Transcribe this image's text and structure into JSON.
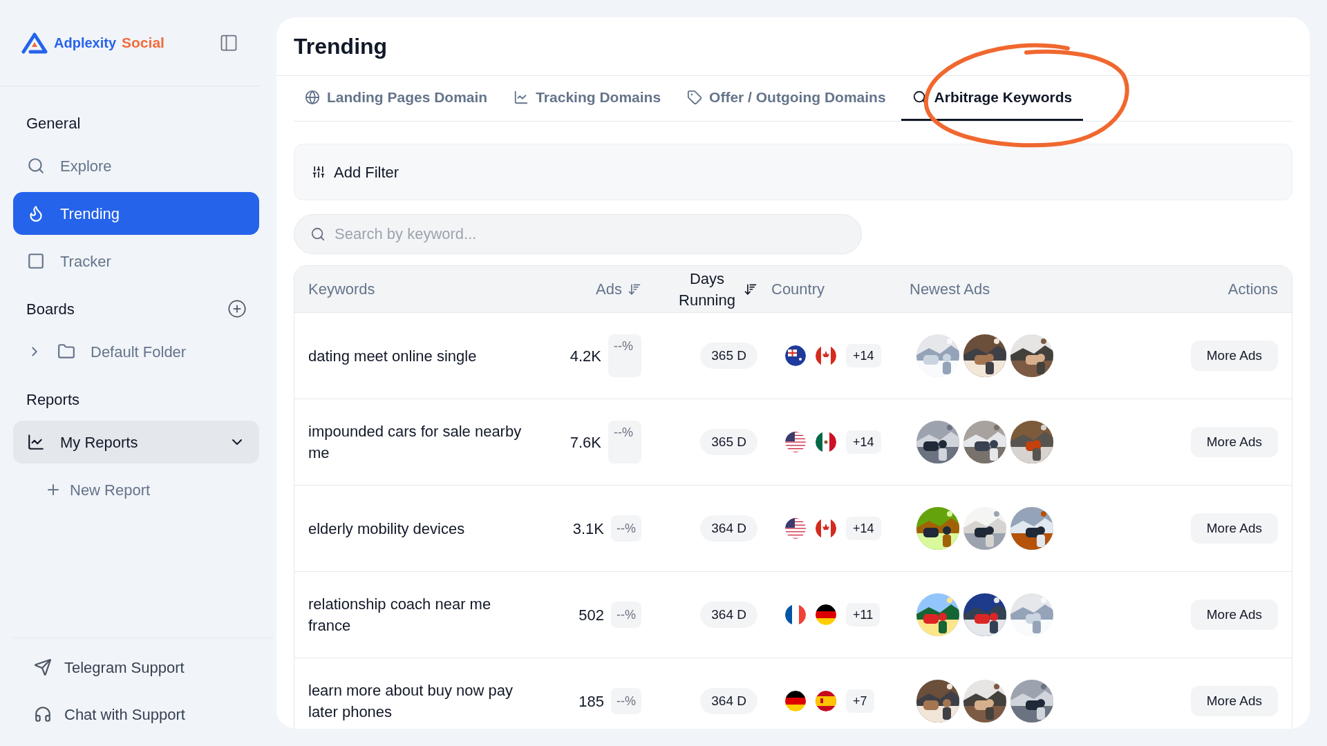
{
  "brand": {
    "name": "Adplexity",
    "suffix": "Social"
  },
  "sidebar": {
    "sections": [
      {
        "title": "General",
        "items": [
          {
            "label": "Explore",
            "selected": false
          },
          {
            "label": "Trending",
            "selected": true
          },
          {
            "label": "Tracker",
            "selected": false
          }
        ]
      },
      {
        "title": "Boards",
        "items": [
          {
            "label": "Default Folder",
            "selected": false,
            "expanded": false
          }
        ]
      },
      {
        "title": "Reports",
        "items": [
          {
            "label": "My Reports",
            "selected": false,
            "expanded": true,
            "children": [
              {
                "label": "New Report"
              }
            ]
          }
        ]
      }
    ],
    "footer": [
      {
        "label": "Telegram Support"
      },
      {
        "label": "Chat with Support"
      }
    ]
  },
  "page": {
    "title": "Trending"
  },
  "tabs": [
    {
      "label": "Landing Pages Domain",
      "selected": false
    },
    {
      "label": "Tracking Domains",
      "selected": false
    },
    {
      "label": "Offer / Outgoing Domains",
      "selected": false
    },
    {
      "label": "Arbitrage Keywords",
      "selected": true
    }
  ],
  "filter": {
    "label": "Add Filter"
  },
  "search": {
    "placeholder": "Search by keyword..."
  },
  "table": {
    "columns": [
      {
        "label": "Keywords",
        "sortable": false
      },
      {
        "label": "Ads",
        "sortable": true
      },
      {
        "label": "Days Running",
        "sortable": true
      },
      {
        "label": "Country",
        "sortable": false
      },
      {
        "label": "Newest Ads",
        "sortable": false
      },
      {
        "label": "Actions",
        "sortable": false
      }
    ],
    "rows": [
      {
        "keyword": "dating meet online single",
        "ads": "4.2K",
        "change": "--%",
        "days": "365 D",
        "flags": [
          {
            "kind": "australia"
          },
          {
            "kind": "canada"
          }
        ],
        "more_countries": "+14",
        "action": "More Ads"
      },
      {
        "keyword": "impounded cars for sale nearby me",
        "ads": "7.6K",
        "change": "--%",
        "days": "365 D",
        "flags": [
          {
            "kind": "usa"
          },
          {
            "kind": "mexico"
          }
        ],
        "more_countries": "+14",
        "action": "More Ads"
      },
      {
        "keyword": "elderly mobility devices",
        "ads": "3.1K",
        "change": "--%",
        "days": "364 D",
        "flags": [
          {
            "kind": "usa"
          },
          {
            "kind": "canada"
          }
        ],
        "more_countries": "+14",
        "action": "More Ads"
      },
      {
        "keyword": "relationship coach near me france",
        "ads": "502",
        "change": "--%",
        "days": "364 D",
        "flags": [
          {
            "kind": "france"
          },
          {
            "kind": "germany"
          }
        ],
        "more_countries": "+11",
        "action": "More Ads"
      },
      {
        "keyword": "learn more about buy now pay later phones",
        "ads": "185",
        "change": "--%",
        "days": "364 D",
        "flags": [
          {
            "kind": "germany"
          },
          {
            "kind": "spain"
          }
        ],
        "more_countries": "+7",
        "action": "More Ads"
      }
    ]
  }
}
